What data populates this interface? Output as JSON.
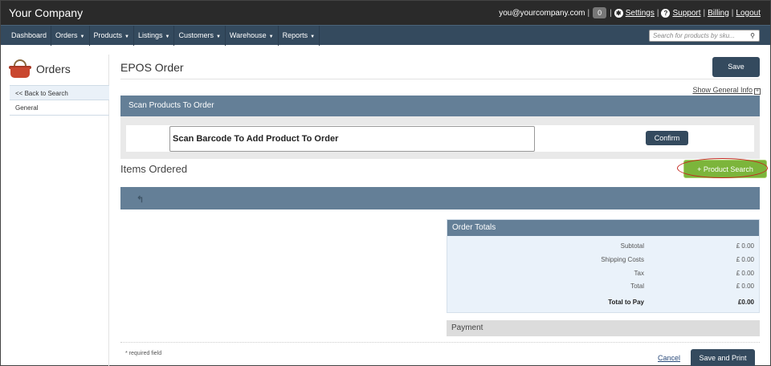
{
  "topbar": {
    "brand": "Your Company",
    "email": "you@yourcompany.com",
    "badge_count": "0",
    "settings": "Settings",
    "support": "Support",
    "billing": "Billing",
    "logout": "Logout"
  },
  "nav": {
    "items": [
      {
        "label": "Dashboard",
        "has_caret": false
      },
      {
        "label": "Orders",
        "has_caret": true
      },
      {
        "label": "Products",
        "has_caret": true
      },
      {
        "label": "Listings",
        "has_caret": true
      },
      {
        "label": "Customers",
        "has_caret": true
      },
      {
        "label": "Warehouse",
        "has_caret": true
      },
      {
        "label": "Reports",
        "has_caret": true
      }
    ],
    "search_placeholder": "Search for products by sku..."
  },
  "sidebar": {
    "title": "Orders",
    "links": [
      "<< Back to Search",
      "General"
    ]
  },
  "main": {
    "title": "EPOS Order",
    "save_label": "Save",
    "show_info": "Show General Info",
    "scan_panel_title": "Scan Products To Order",
    "scan_input_value": "Scan Barcode To Add Product To Order",
    "confirm_label": "Confirm",
    "items_title": "Items Ordered",
    "product_search_label": "Product Search"
  },
  "totals": {
    "title": "Order Totals",
    "rows": [
      {
        "label": "Subtotal",
        "value": "£ 0.00"
      },
      {
        "label": "Shipping Costs",
        "value": "£ 0.00"
      },
      {
        "label": "Tax",
        "value": "£ 0.00"
      },
      {
        "label": "Total",
        "value": "£ 0.00"
      }
    ],
    "total_to_pay_label": "Total to Pay",
    "total_to_pay_value": "£0.00"
  },
  "payment": {
    "title": "Payment"
  },
  "footer": {
    "required_note": "* required field",
    "cancel_label": "Cancel",
    "save_print_label": "Save and Print"
  },
  "colors": {
    "topbar": "#2a2a2a",
    "navbar": "#344a5e",
    "panel_header": "#647f97",
    "accent_green": "#7cb53b",
    "highlight_ring": "#c4281f"
  },
  "icons": [
    "gear-icon",
    "help-icon",
    "search-icon",
    "basket-icon",
    "plus-icon",
    "return-arrow-icon"
  ]
}
